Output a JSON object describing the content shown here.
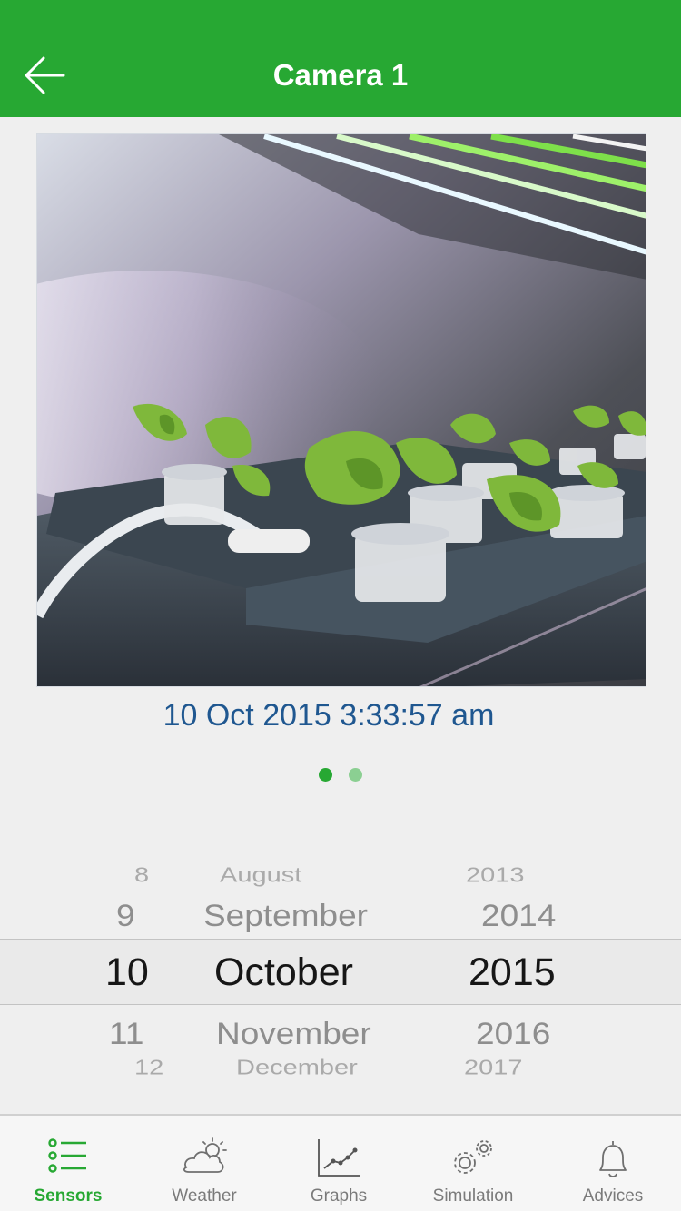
{
  "header": {
    "title": "Camera 1"
  },
  "photo": {
    "timestamp": "10 Oct 2015 3:33:57 am"
  },
  "pager": {
    "active_index": 0,
    "count": 2
  },
  "date_picker": {
    "days": [
      "8",
      "9",
      "10",
      "11",
      "12"
    ],
    "months": [
      "August",
      "September",
      "October",
      "November",
      "December"
    ],
    "years": [
      "2013",
      "2014",
      "2015",
      "2016",
      "2017"
    ],
    "selected": {
      "day": "10",
      "month": "October",
      "year": "2015"
    }
  },
  "tabs": [
    {
      "label": "Sensors",
      "icon": "list-icon",
      "active": true
    },
    {
      "label": "Weather",
      "icon": "cloud-sun-icon",
      "active": false
    },
    {
      "label": "Graphs",
      "icon": "line-chart-icon",
      "active": false
    },
    {
      "label": "Simulation",
      "icon": "gears-icon",
      "active": false
    },
    {
      "label": "Advices",
      "icon": "bell-icon",
      "active": false
    }
  ],
  "colors": {
    "brand_green": "#27a833",
    "timestamp_blue": "#1f5790"
  }
}
